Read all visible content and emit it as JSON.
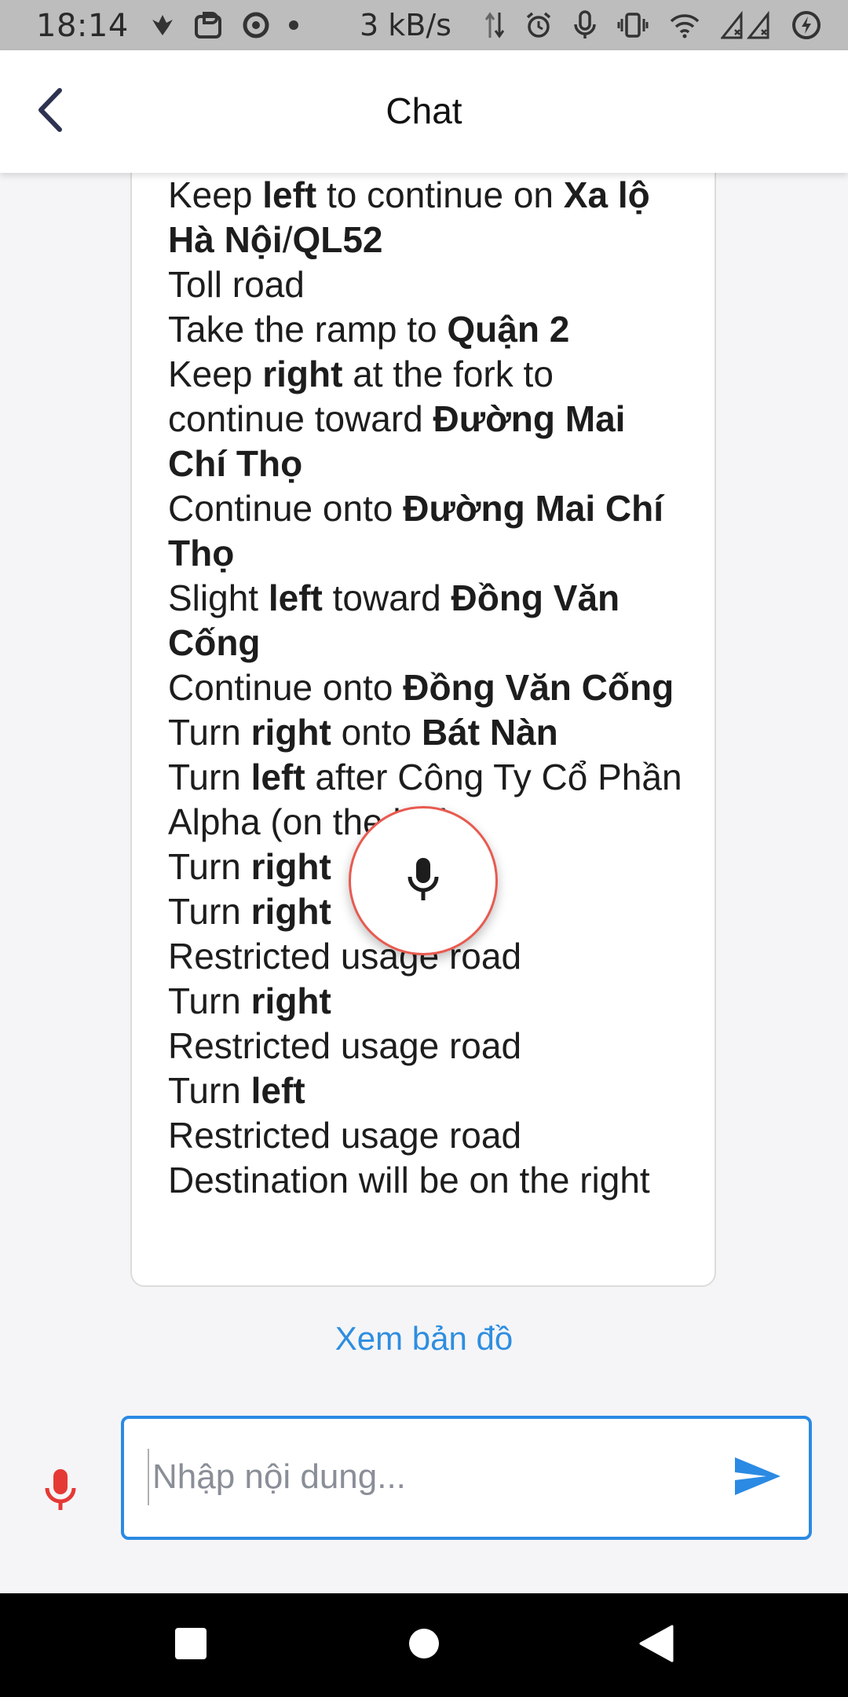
{
  "status_bar": {
    "time": "18:14",
    "speed": "3 kB/s",
    "left_icons": [
      "notification-icon",
      "app-icon",
      "record-icon",
      "dot-icon"
    ],
    "right_icons": [
      "data-arrows-icon",
      "alarm-icon",
      "mic-icon",
      "vibrate-icon",
      "wifi-icon",
      "signal-icon",
      "battery-icon"
    ]
  },
  "header": {
    "title": "Chat",
    "back_icon": "chevron-left-icon"
  },
  "message": {
    "steps": [
      {
        "segments": [
          {
            "t": "Keep ",
            "b": false
          },
          {
            "t": "left",
            "b": true
          },
          {
            "t": " to continue on ",
            "b": false
          },
          {
            "t": "Xa lộ Hà Nội",
            "b": true
          },
          {
            "t": "/",
            "b": false
          },
          {
            "t": "QL52",
            "b": true
          }
        ]
      },
      {
        "segments": [
          {
            "t": "Toll road",
            "b": false
          }
        ]
      },
      {
        "segments": [
          {
            "t": "Take the ramp to ",
            "b": false
          },
          {
            "t": "Quận 2",
            "b": true
          }
        ]
      },
      {
        "segments": [
          {
            "t": "Keep ",
            "b": false
          },
          {
            "t": "right",
            "b": true
          },
          {
            "t": " at the fork to continue toward ",
            "b": false
          },
          {
            "t": "Đường Mai Chí Thọ",
            "b": true
          }
        ]
      },
      {
        "segments": [
          {
            "t": "Continue onto ",
            "b": false
          },
          {
            "t": "Đường Mai Chí Thọ",
            "b": true
          }
        ]
      },
      {
        "segments": [
          {
            "t": "Slight ",
            "b": false
          },
          {
            "t": "left",
            "b": true
          },
          {
            "t": " toward ",
            "b": false
          },
          {
            "t": "Đồng Văn Cống",
            "b": true
          }
        ]
      },
      {
        "segments": [
          {
            "t": "Continue onto ",
            "b": false
          },
          {
            "t": "Đồng Văn Cống",
            "b": true
          }
        ]
      },
      {
        "segments": [
          {
            "t": "Turn ",
            "b": false
          },
          {
            "t": "right",
            "b": true
          },
          {
            "t": " onto ",
            "b": false
          },
          {
            "t": "Bát Nàn",
            "b": true
          }
        ]
      },
      {
        "segments": [
          {
            "t": "Turn ",
            "b": false
          },
          {
            "t": "left",
            "b": true
          },
          {
            "t": " after Công Ty Cổ Phần Alpha (on the left)",
            "b": false
          }
        ]
      },
      {
        "segments": [
          {
            "t": "Turn ",
            "b": false
          },
          {
            "t": "right",
            "b": true
          }
        ]
      },
      {
        "segments": [
          {
            "t": "Turn ",
            "b": false
          },
          {
            "t": "right",
            "b": true
          }
        ]
      },
      {
        "segments": [
          {
            "t": "Restricted usage road",
            "b": false
          }
        ]
      },
      {
        "segments": [
          {
            "t": "Turn ",
            "b": false
          },
          {
            "t": "right",
            "b": true
          }
        ]
      },
      {
        "segments": [
          {
            "t": "Restricted usage road",
            "b": false
          }
        ]
      },
      {
        "segments": [
          {
            "t": "Turn ",
            "b": false
          },
          {
            "t": "left",
            "b": true
          }
        ]
      },
      {
        "segments": [
          {
            "t": "Restricted usage road",
            "b": false
          }
        ]
      },
      {
        "segments": [
          {
            "t": "Destination will be on the right",
            "b": false
          }
        ]
      }
    ],
    "view_map_link": "Xem bản đồ"
  },
  "floating_mic": {
    "icon": "mic-icon",
    "border_color": "#e85a50"
  },
  "composer": {
    "mic_icon": "mic-icon",
    "mic_color": "#e53935",
    "placeholder": "Nhập nội dung...",
    "value": "",
    "send_icon": "send-icon",
    "accent_color": "#2b8ae3"
  },
  "nav_bar": {
    "buttons": [
      "recents-square-icon",
      "home-circle-icon",
      "back-triangle-icon"
    ]
  }
}
